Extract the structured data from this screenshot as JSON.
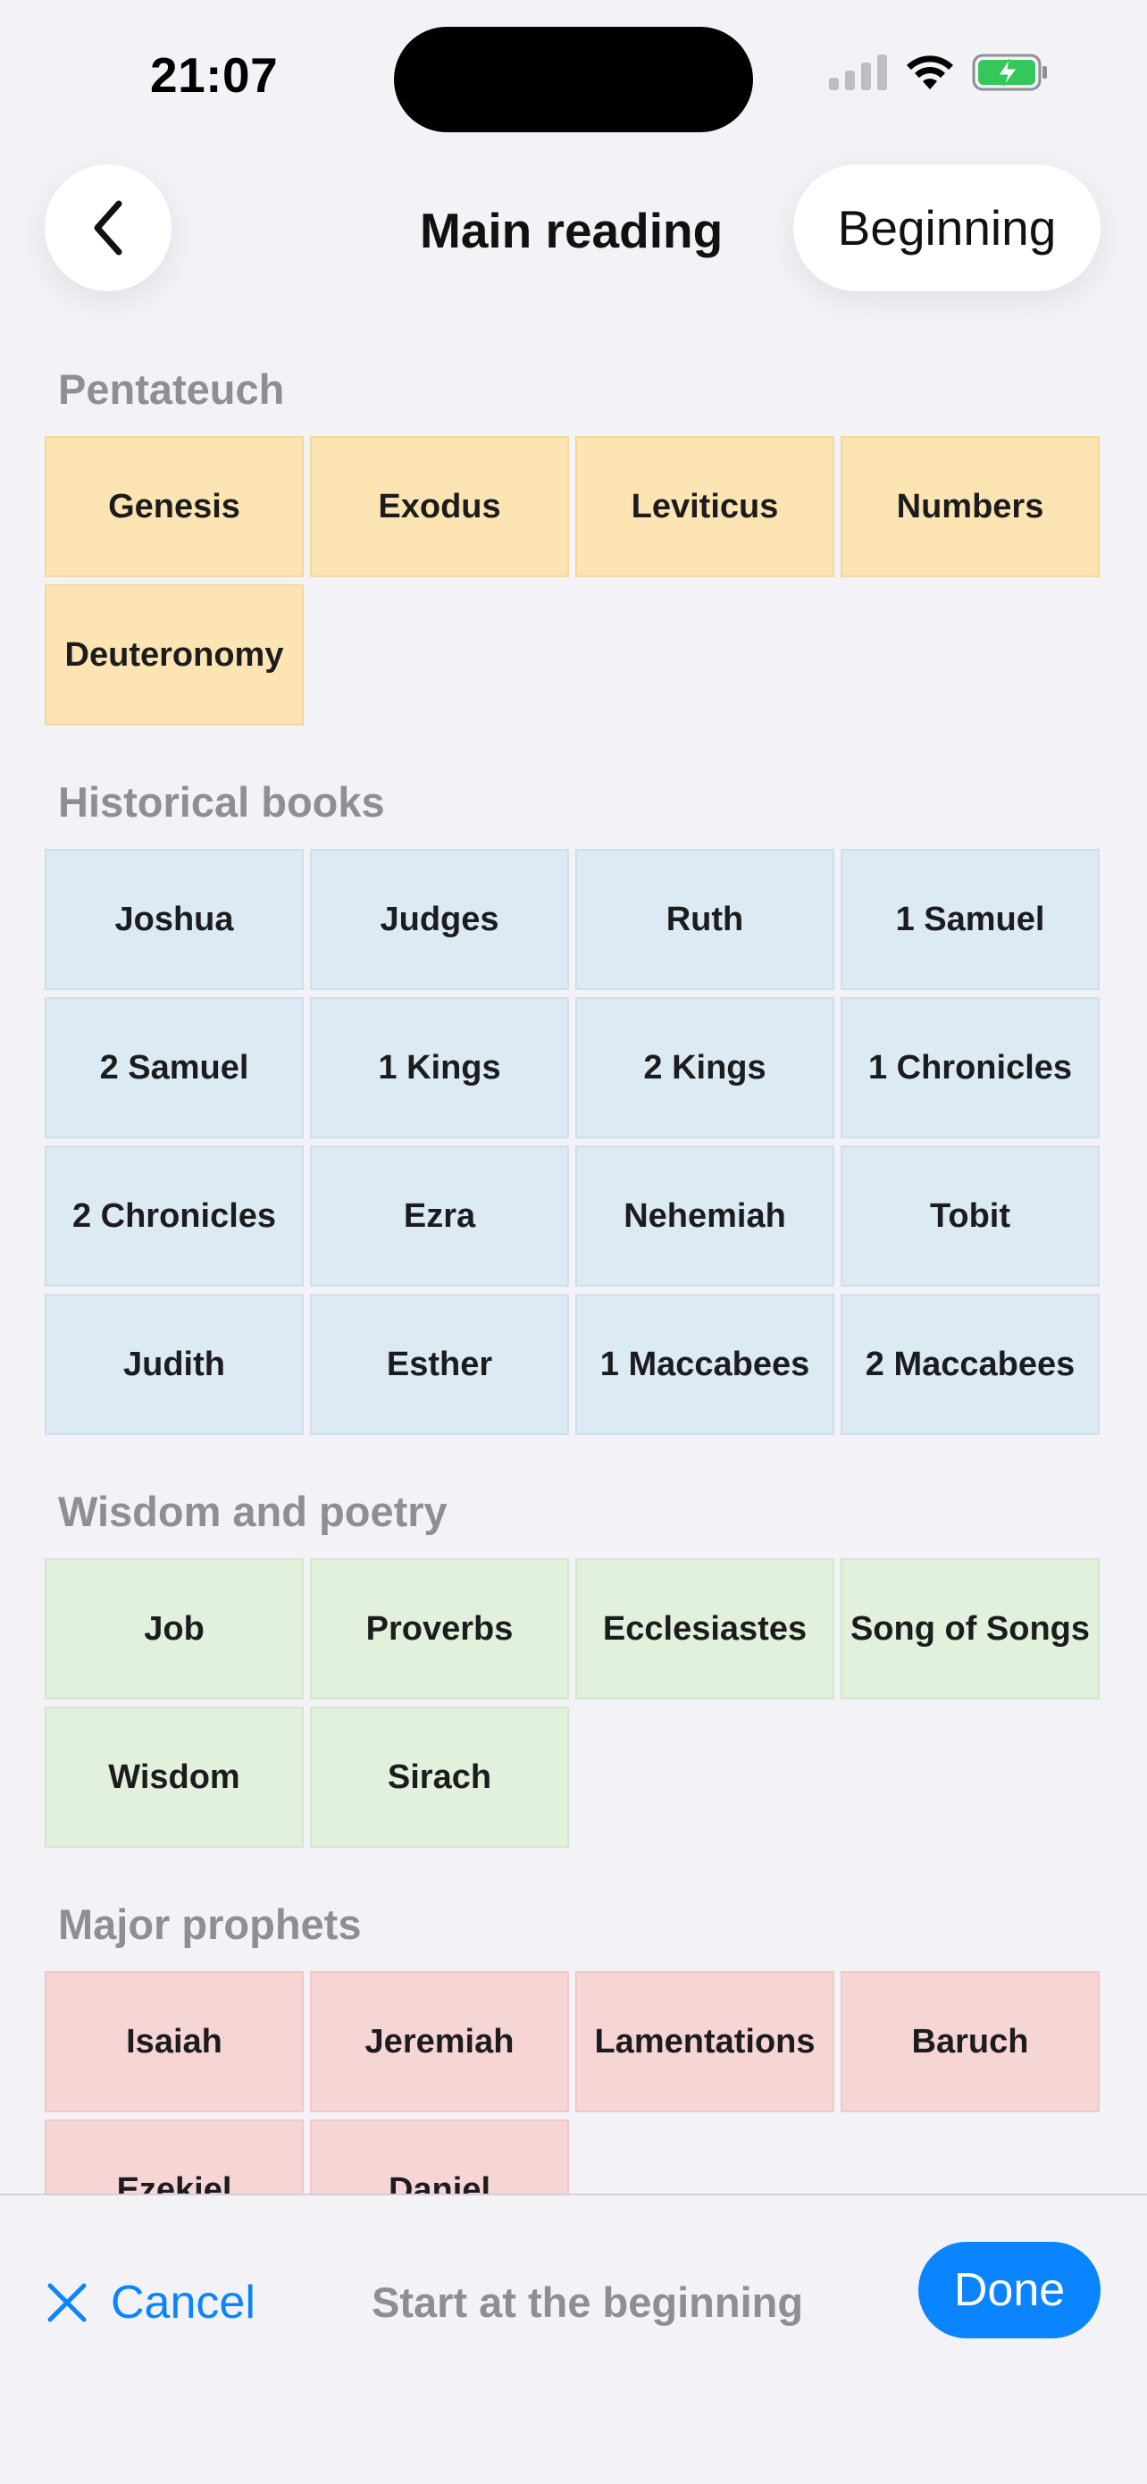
{
  "status_bar": {
    "time": "21:07"
  },
  "header": {
    "title": "Main reading",
    "right_button": "Beginning",
    "back_icon": "chevron-left-icon"
  },
  "sections": [
    {
      "title": "Pentateuch",
      "color": "#fce4b3",
      "books": [
        "Genesis",
        "Exodus",
        "Leviticus",
        "Numbers",
        "Deuteronomy"
      ]
    },
    {
      "title": "Historical books",
      "color": "#dbeaf3",
      "books": [
        "Joshua",
        "Judges",
        "Ruth",
        "1 Samuel",
        "2 Samuel",
        "1 Kings",
        "2 Kings",
        "1 Chronicles",
        "2 Chronicles",
        "Ezra",
        "Nehemiah",
        "Tobit",
        "Judith",
        "Esther",
        "1 Maccabees",
        "2 Maccabees"
      ]
    },
    {
      "title": "Wisdom and poetry",
      "color": "#e1f1dc",
      "books": [
        "Job",
        "Proverbs",
        "Ecclesiastes",
        "Song of Songs",
        "Wisdom",
        "Sirach"
      ]
    },
    {
      "title": "Major prophets",
      "color": "#f6d6d5",
      "books": [
        "Isaiah",
        "Jeremiah",
        "Lamentations",
        "Baruch",
        "Ezekiel",
        "Daniel"
      ]
    }
  ],
  "bottom_bar": {
    "cancel_label": "Cancel",
    "status_text": "Start at the beginning",
    "done_label": "Done"
  },
  "colors": {
    "accent": "#0a84ff",
    "background": "#f2f2f7"
  }
}
